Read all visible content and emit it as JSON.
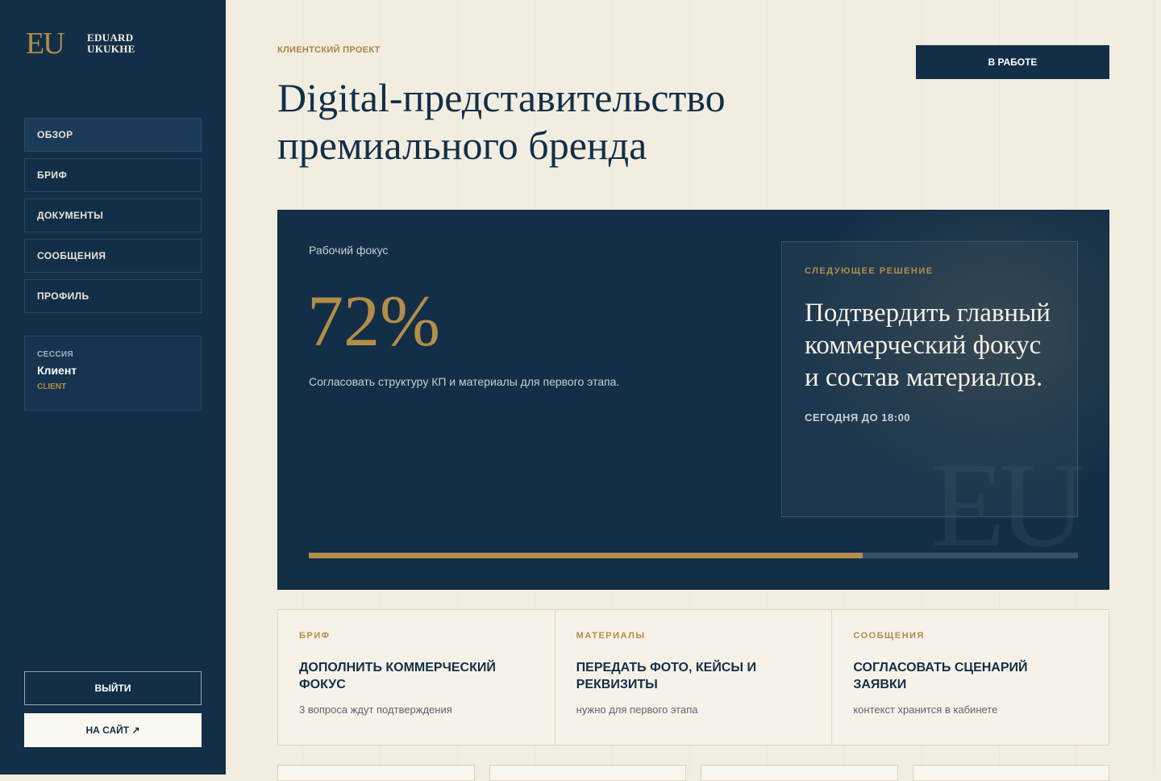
{
  "sidebar": {
    "logo_mark": "EU",
    "logo_line1": "EDUARD",
    "logo_line2": "UKUKHE",
    "nav": [
      {
        "label": "ОБЗОР",
        "active": true
      },
      {
        "label": "БРИФ"
      },
      {
        "label": "ДОКУМЕНТЫ"
      },
      {
        "label": "СООБЩЕНИЯ"
      },
      {
        "label": "ПРОФИЛЬ"
      }
    ],
    "session": {
      "label": "СЕССИЯ",
      "name": "Клиент",
      "role": "CLIENT"
    },
    "logout_label": "ВЫЙТИ",
    "site_label": "НА САЙТ ↗"
  },
  "header": {
    "eyebrow": "КЛИЕНТСКИЙ ПРОЕКТ",
    "title": "Digital-представительство премиального бренда",
    "status_label": "В РАБОТЕ"
  },
  "hero": {
    "focus_label": "Рабочий фокус",
    "focus_value": "72%",
    "progress_fraction": 0.72,
    "focus_desc": "Согласовать структуру КП и материалы для первого этапа.",
    "watermark": "EU",
    "next": {
      "label": "СЛЕДУЮЩЕЕ РЕШЕНИЕ",
      "text": "Подтвердить главный коммерческий фокус и состав материалов.",
      "deadline": "СЕГОДНЯ ДО 18:00"
    }
  },
  "tasks": [
    {
      "category": "БРИФ",
      "title": "ДОПОЛНИТЬ КОММЕРЧЕСКИЙ ФОКУС",
      "note": "3 вопроса ждут подтверждения"
    },
    {
      "category": "МАТЕРИАЛЫ",
      "title": "ПЕРЕДАТЬ ФОТО, КЕЙСЫ И РЕКВИЗИТЫ",
      "note": "нужно для первого этапа"
    },
    {
      "category": "СООБЩЕНИЯ",
      "title": "СОГЛАСОВАТЬ СЦЕНАРИЙ ЗАЯВКИ",
      "note": "контекст хранится в кабинете"
    }
  ],
  "colors": {
    "navy": "#132f47",
    "gold": "#b38d4a",
    "cream": "#f2ede1"
  }
}
